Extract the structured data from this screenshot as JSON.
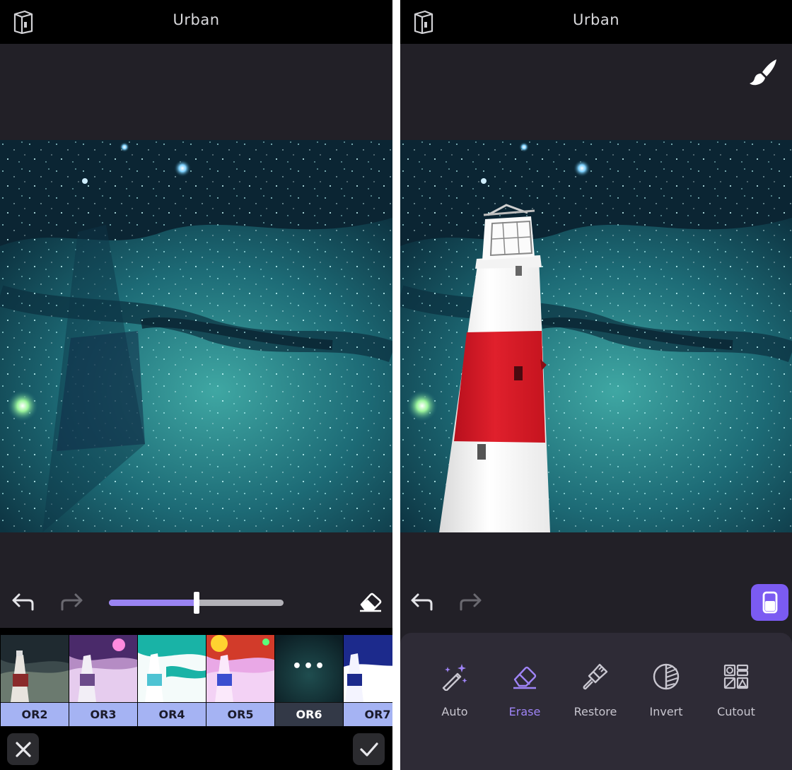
{
  "left_screen": {
    "title": "Urban",
    "slider": {
      "value_fraction": 0.5
    },
    "filters": [
      {
        "label": "OR2",
        "selected": false
      },
      {
        "label": "OR3",
        "selected": false
      },
      {
        "label": "OR4",
        "selected": false
      },
      {
        "label": "OR5",
        "selected": false
      },
      {
        "label": "OR6",
        "selected": true,
        "more_glyph": "•••"
      },
      {
        "label": "OR7",
        "selected": false
      }
    ],
    "icons": {
      "logo": "app-logo-icon",
      "undo": "undo-icon",
      "redo": "redo-icon",
      "eraser": "eraser-icon",
      "cancel": "close-icon",
      "confirm": "checkmark-icon"
    }
  },
  "right_screen": {
    "title": "Urban",
    "tools": [
      {
        "label": "Auto",
        "icon": "magic-wand-icon",
        "active": false
      },
      {
        "label": "Erase",
        "icon": "eraser-icon",
        "active": true
      },
      {
        "label": "Restore",
        "icon": "brush-icon",
        "active": false
      },
      {
        "label": "Invert",
        "icon": "invert-icon",
        "active": false
      },
      {
        "label": "Cutout",
        "icon": "cutout-grid-icon",
        "active": false
      }
    ]
  },
  "colors": {
    "accent": "#7b5bf2",
    "accent_text": "#9f84f7",
    "filter_label_bg": "#a5b3f3",
    "panel_bg": "#222027",
    "topbar_bg": "#000000"
  }
}
